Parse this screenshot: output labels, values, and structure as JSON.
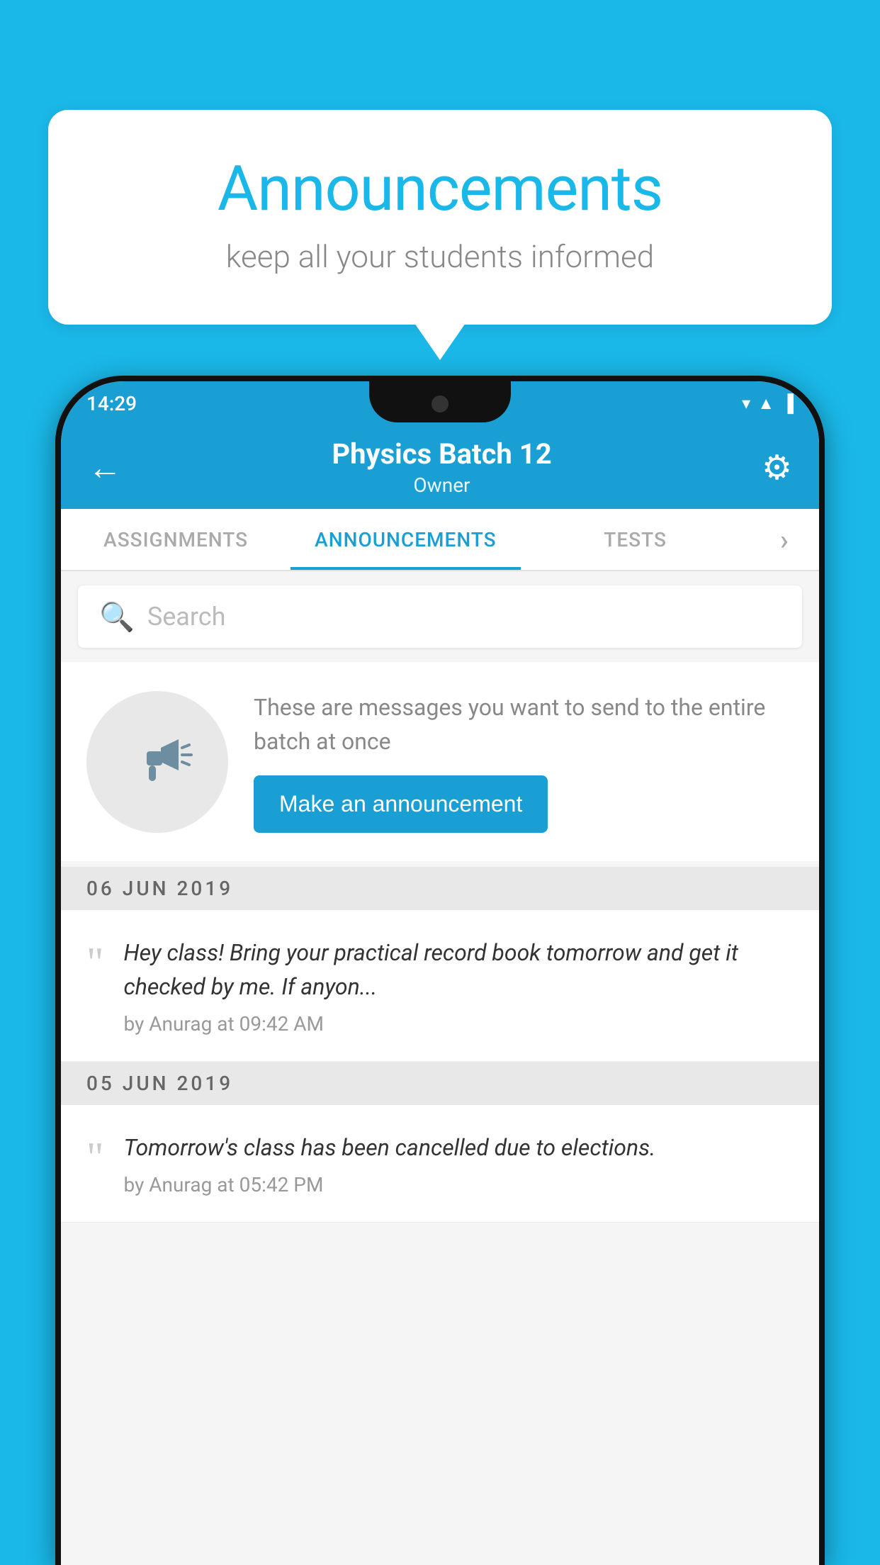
{
  "bubble": {
    "title": "Announcements",
    "subtitle": "keep all your students informed"
  },
  "statusBar": {
    "time": "14:29",
    "icons": [
      "wifi",
      "signal",
      "battery"
    ]
  },
  "header": {
    "title": "Physics Batch 12",
    "subtitle": "Owner",
    "backLabel": "←",
    "gearLabel": "⚙"
  },
  "tabs": [
    {
      "label": "ASSIGNMENTS",
      "active": false
    },
    {
      "label": "ANNOUNCEMENTS",
      "active": true
    },
    {
      "label": "TESTS",
      "active": false
    },
    {
      "label": "·",
      "active": false
    }
  ],
  "search": {
    "placeholder": "Search"
  },
  "prompt": {
    "text": "These are messages you want to send to the entire batch at once",
    "button": "Make an announcement"
  },
  "announcements": [
    {
      "date": "06  JUN  2019",
      "text": "Hey class! Bring your practical record book tomorrow and get it checked by me. If anyon...",
      "meta": "by Anurag at 09:42 AM"
    },
    {
      "date": "05  JUN  2019",
      "text": "Tomorrow's class has been cancelled due to elections.",
      "meta": "by Anurag at 05:42 PM"
    }
  ]
}
